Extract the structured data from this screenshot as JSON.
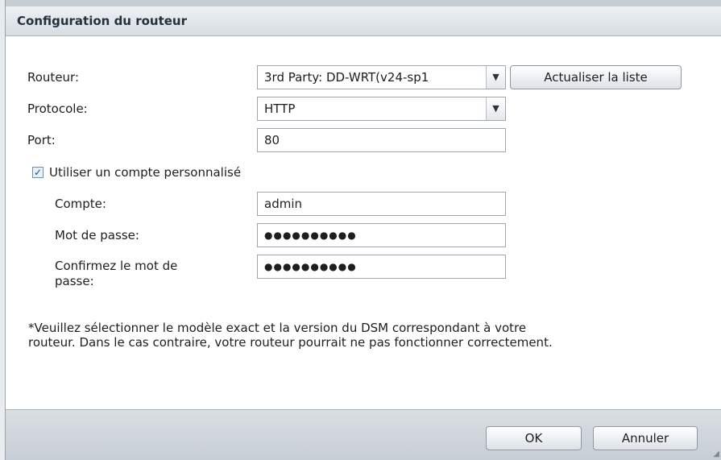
{
  "dialog": {
    "title": "Configuration du routeur"
  },
  "form": {
    "router_label": "Routeur:",
    "router_value": "3rd Party: DD-WRT(v24-sp1",
    "refresh_button": "Actualiser la liste",
    "protocol_label": "Protocole:",
    "protocol_value": "HTTP",
    "port_label": "Port:",
    "port_value": "80",
    "custom_account_checkbox": "Utiliser un compte personnalisé",
    "custom_account_checked": true,
    "account_label": "Compte:",
    "account_value": "admin",
    "password_label": "Mot de passe:",
    "password_value": "●●●●●●●●●●",
    "confirm_label_line1": "Confirmez le mot de",
    "confirm_label_line2": "passe:",
    "confirm_value": "●●●●●●●●●●"
  },
  "note": {
    "line1": "*Veuillez sélectionner le modèle exact et la version du DSM correspondant à votre",
    "line2": "routeur. Dans le cas contraire, votre routeur pourrait ne pas fonctionner correctement."
  },
  "footer": {
    "ok_button": "OK",
    "cancel_button": "Annuler"
  }
}
